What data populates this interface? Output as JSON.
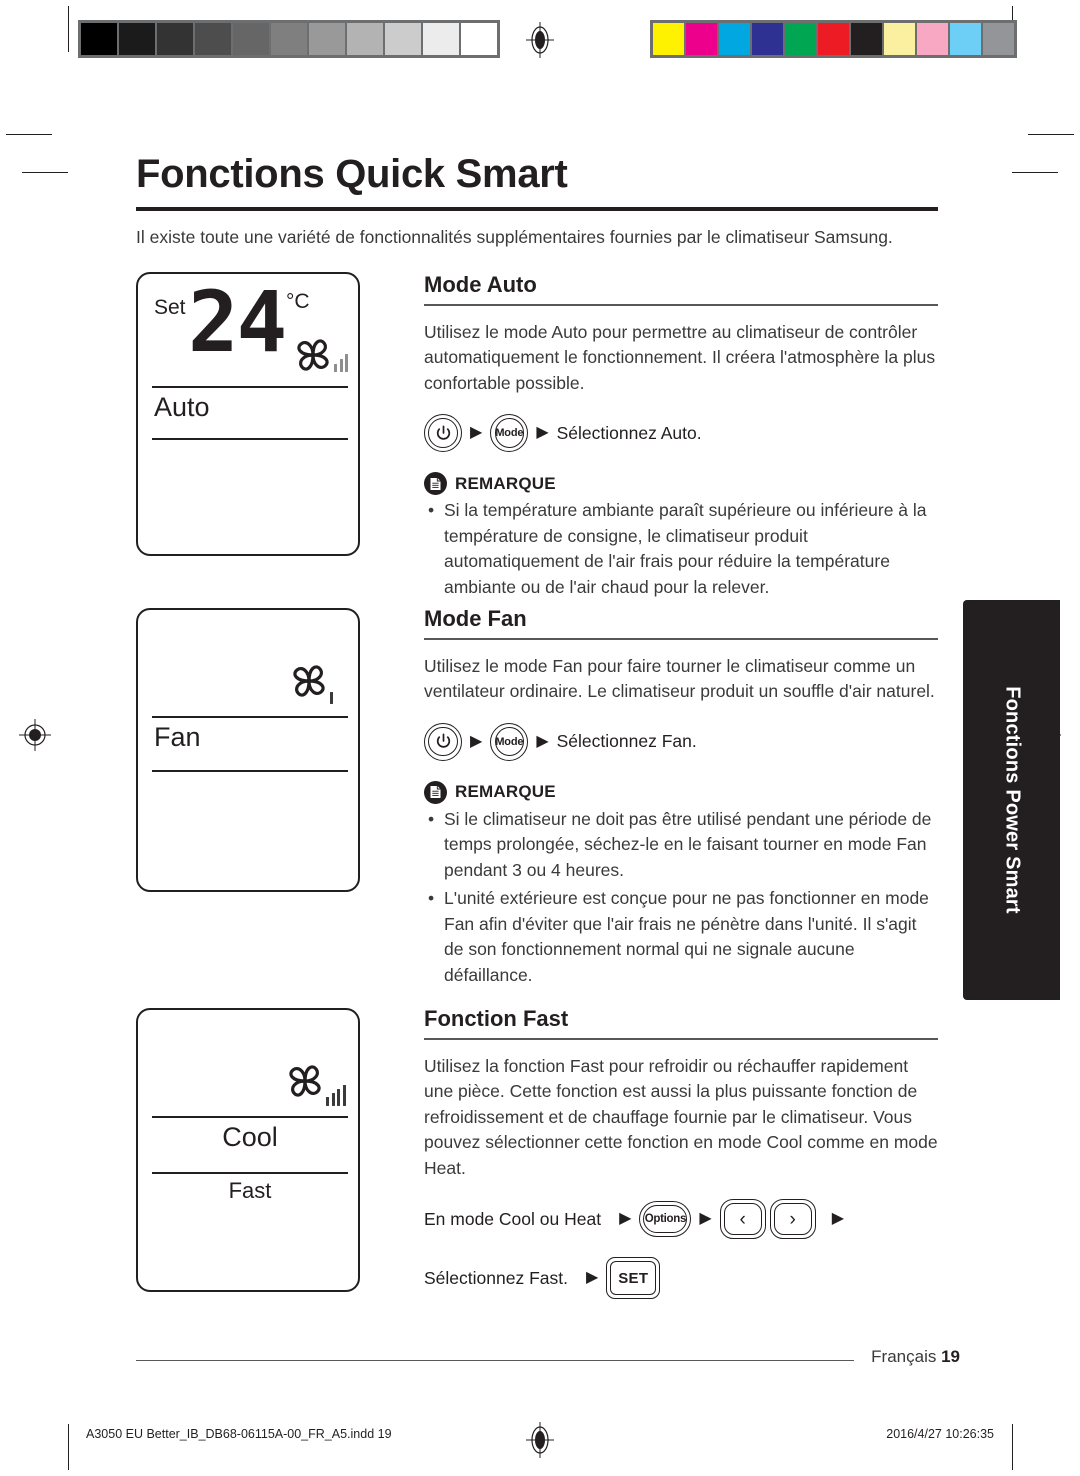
{
  "document": {
    "title": "Fonctions Quick Smart",
    "intro": "Il existe toute une variété de fonctionnalités supplémentaires fournies par le climatiseur Samsung.",
    "side_tab_label": "Fonctions Power Smart",
    "footer": {
      "language": "Français",
      "page_number": "19"
    },
    "print_bar": {
      "file": "A3050 EU Better_IB_DB68-06115A-00_FR_A5.indd   19",
      "date": "2016/4/27   10:26:35"
    }
  },
  "colors": {
    "ink": "#231f20",
    "body_text": "#3a3a3c",
    "rule": "#58585b",
    "tab_background": "#231f20",
    "tab_text": "#ffffff"
  },
  "calibration": {
    "gray_strip": [
      "#000000",
      "#1b1b1b",
      "#333333",
      "#4d4d4d",
      "#666666",
      "#7f7f7f",
      "#999999",
      "#b3b3b3",
      "#cccccc",
      "#ececec",
      "#ffffff"
    ],
    "color_strip": [
      "#fff200",
      "#ec008c",
      "#00a7e1",
      "#2e3192",
      "#00a651",
      "#ed1c24",
      "#231f20",
      "#faf0a0",
      "#f9a8c4",
      "#6dcff6",
      "#939598"
    ]
  },
  "displays": [
    {
      "name": "auto-display",
      "set_label": "Set",
      "temperature": "24",
      "unit": "°C",
      "mode_text": "Auto",
      "fan_bars": 3,
      "fan_bar_style": "graduated"
    },
    {
      "name": "fan-display",
      "set_label": "",
      "temperature": "",
      "unit": "",
      "mode_text": "Fan",
      "fan_bars": 1,
      "fan_bar_style": "single"
    },
    {
      "name": "fast-display",
      "set_label": "",
      "temperature": "",
      "unit": "",
      "mode_text": "Cool",
      "sub_text": "Fast",
      "fan_bars": 5,
      "fan_bar_style": "graduated"
    }
  ],
  "sections": [
    {
      "id": "auto",
      "heading": "Mode Auto",
      "body": "Utilisez le mode Auto pour permettre au climatiseur de contrôler automatiquement le fonctionnement. Il créera l'atmosphère la plus confortable possible.",
      "steps": {
        "power_button": "power-icon",
        "mode_button": "Mode",
        "instruction": "Sélectionnez Auto."
      },
      "remark": {
        "title": "REMARQUE",
        "bullets": [
          "Si la température ambiante paraît supérieure ou inférieure à la température de consigne, le climatiseur produit automatiquement de l'air frais pour réduire la température ambiante ou de l'air chaud pour la relever."
        ]
      }
    },
    {
      "id": "fan",
      "heading": "Mode Fan",
      "body": "Utilisez le mode Fan pour faire tourner le climatiseur comme un ventilateur ordinaire. Le climatiseur produit un souffle d'air naturel.",
      "steps": {
        "power_button": "power-icon",
        "mode_button": "Mode",
        "instruction": "Sélectionnez Fan."
      },
      "remark": {
        "title": "REMARQUE",
        "bullets": [
          "Si le climatiseur ne doit pas être utilisé pendant une période de temps prolongée, séchez-le en le faisant tourner en mode Fan pendant 3 ou 4 heures.",
          "L'unité extérieure est conçue pour ne pas fonctionner en mode Fan afin d'éviter que l'air frais ne pénètre dans l'unité. Il s'agit de son fonctionnement normal qui ne signale aucune défaillance."
        ]
      }
    },
    {
      "id": "fast",
      "heading": "Fonction Fast",
      "body": "Utilisez la fonction Fast pour refroidir ou réchauffer rapidement une pièce. Cette fonction est aussi la plus puissante fonction de refroidissement et de chauffage fournie par le climatiseur. Vous pouvez sélectionner cette fonction en mode Cool comme en mode Heat.",
      "steps_fast": {
        "line1_text": "En mode Cool ou Heat",
        "options_button": "Options",
        "left_arrow": "‹",
        "right_arrow": "›",
        "line2_text": "Sélectionnez Fast.",
        "set_button": "SET"
      }
    }
  ]
}
